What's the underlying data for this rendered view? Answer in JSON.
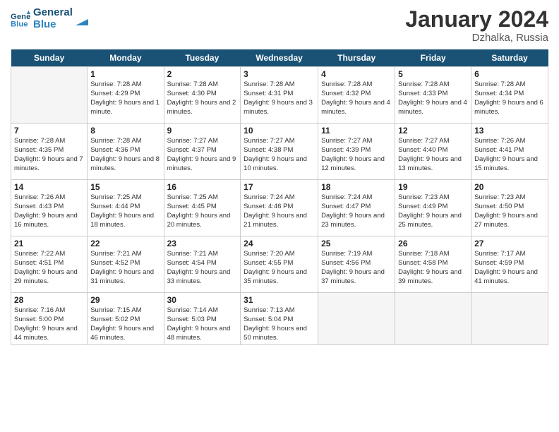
{
  "header": {
    "logo_line1": "General",
    "logo_line2": "Blue",
    "month_title": "January 2024",
    "location": "Dzhalka, Russia"
  },
  "days_of_week": [
    "Sunday",
    "Monday",
    "Tuesday",
    "Wednesday",
    "Thursday",
    "Friday",
    "Saturday"
  ],
  "weeks": [
    [
      {
        "num": "",
        "empty": true
      },
      {
        "num": "1",
        "rise": "7:28 AM",
        "set": "4:29 PM",
        "daylight": "9 hours and 1 minute."
      },
      {
        "num": "2",
        "rise": "7:28 AM",
        "set": "4:30 PM",
        "daylight": "9 hours and 2 minutes."
      },
      {
        "num": "3",
        "rise": "7:28 AM",
        "set": "4:31 PM",
        "daylight": "9 hours and 3 minutes."
      },
      {
        "num": "4",
        "rise": "7:28 AM",
        "set": "4:32 PM",
        "daylight": "9 hours and 4 minutes."
      },
      {
        "num": "5",
        "rise": "7:28 AM",
        "set": "4:33 PM",
        "daylight": "9 hours and 4 minutes."
      },
      {
        "num": "6",
        "rise": "7:28 AM",
        "set": "4:34 PM",
        "daylight": "9 hours and 6 minutes."
      }
    ],
    [
      {
        "num": "7",
        "rise": "7:28 AM",
        "set": "4:35 PM",
        "daylight": "9 hours and 7 minutes."
      },
      {
        "num": "8",
        "rise": "7:28 AM",
        "set": "4:36 PM",
        "daylight": "9 hours and 8 minutes."
      },
      {
        "num": "9",
        "rise": "7:27 AM",
        "set": "4:37 PM",
        "daylight": "9 hours and 9 minutes."
      },
      {
        "num": "10",
        "rise": "7:27 AM",
        "set": "4:38 PM",
        "daylight": "9 hours and 10 minutes."
      },
      {
        "num": "11",
        "rise": "7:27 AM",
        "set": "4:39 PM",
        "daylight": "9 hours and 12 minutes."
      },
      {
        "num": "12",
        "rise": "7:27 AM",
        "set": "4:40 PM",
        "daylight": "9 hours and 13 minutes."
      },
      {
        "num": "13",
        "rise": "7:26 AM",
        "set": "4:41 PM",
        "daylight": "9 hours and 15 minutes."
      }
    ],
    [
      {
        "num": "14",
        "rise": "7:26 AM",
        "set": "4:43 PM",
        "daylight": "9 hours and 16 minutes."
      },
      {
        "num": "15",
        "rise": "7:25 AM",
        "set": "4:44 PM",
        "daylight": "9 hours and 18 minutes."
      },
      {
        "num": "16",
        "rise": "7:25 AM",
        "set": "4:45 PM",
        "daylight": "9 hours and 20 minutes."
      },
      {
        "num": "17",
        "rise": "7:24 AM",
        "set": "4:46 PM",
        "daylight": "9 hours and 21 minutes."
      },
      {
        "num": "18",
        "rise": "7:24 AM",
        "set": "4:47 PM",
        "daylight": "9 hours and 23 minutes."
      },
      {
        "num": "19",
        "rise": "7:23 AM",
        "set": "4:49 PM",
        "daylight": "9 hours and 25 minutes."
      },
      {
        "num": "20",
        "rise": "7:23 AM",
        "set": "4:50 PM",
        "daylight": "9 hours and 27 minutes."
      }
    ],
    [
      {
        "num": "21",
        "rise": "7:22 AM",
        "set": "4:51 PM",
        "daylight": "9 hours and 29 minutes."
      },
      {
        "num": "22",
        "rise": "7:21 AM",
        "set": "4:52 PM",
        "daylight": "9 hours and 31 minutes."
      },
      {
        "num": "23",
        "rise": "7:21 AM",
        "set": "4:54 PM",
        "daylight": "9 hours and 33 minutes."
      },
      {
        "num": "24",
        "rise": "7:20 AM",
        "set": "4:55 PM",
        "daylight": "9 hours and 35 minutes."
      },
      {
        "num": "25",
        "rise": "7:19 AM",
        "set": "4:56 PM",
        "daylight": "9 hours and 37 minutes."
      },
      {
        "num": "26",
        "rise": "7:18 AM",
        "set": "4:58 PM",
        "daylight": "9 hours and 39 minutes."
      },
      {
        "num": "27",
        "rise": "7:17 AM",
        "set": "4:59 PM",
        "daylight": "9 hours and 41 minutes."
      }
    ],
    [
      {
        "num": "28",
        "rise": "7:16 AM",
        "set": "5:00 PM",
        "daylight": "9 hours and 44 minutes."
      },
      {
        "num": "29",
        "rise": "7:15 AM",
        "set": "5:02 PM",
        "daylight": "9 hours and 46 minutes."
      },
      {
        "num": "30",
        "rise": "7:14 AM",
        "set": "5:03 PM",
        "daylight": "9 hours and 48 minutes."
      },
      {
        "num": "31",
        "rise": "7:13 AM",
        "set": "5:04 PM",
        "daylight": "9 hours and 50 minutes."
      },
      {
        "num": "",
        "empty": true
      },
      {
        "num": "",
        "empty": true
      },
      {
        "num": "",
        "empty": true
      }
    ]
  ],
  "labels": {
    "sunrise": "Sunrise:",
    "sunset": "Sunset:",
    "daylight": "Daylight:"
  }
}
